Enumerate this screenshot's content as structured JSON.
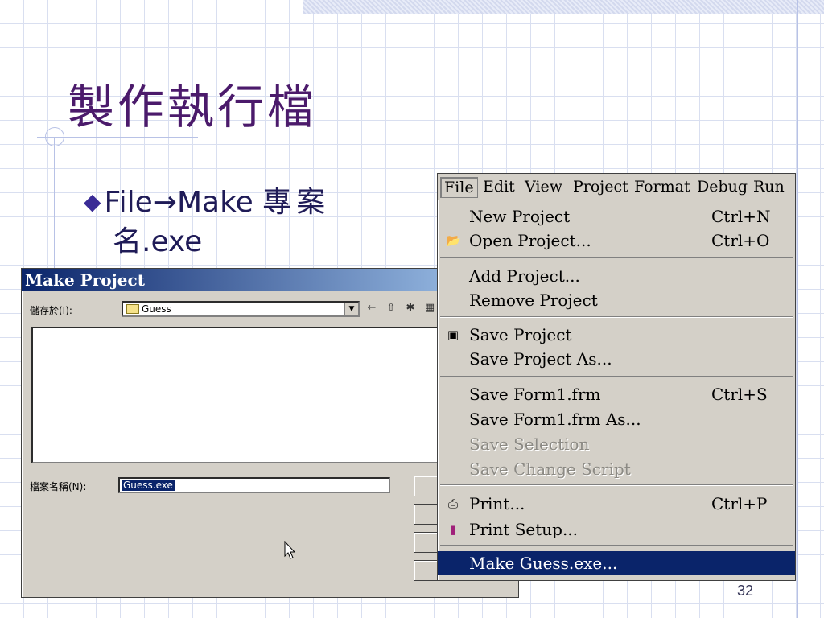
{
  "slide": {
    "title": "製作執行檔",
    "bullet_text_1": "File",
    "bullet_arrow": "→",
    "bullet_text_2": "Make ",
    "bullet_cjk_1": "專案",
    "bullet_cjk_2": "名",
    "bullet_ext": ".exe",
    "bullet_icon": "diamond-bullet-icon",
    "page_number": "32"
  },
  "dialog": {
    "title": "Make Project",
    "save_in_label": "儲存於(I):",
    "save_in_value": "Guess",
    "file_name_label": "檔案名稱(N):",
    "file_name_value": "Guess.exe",
    "toolbar_icons": [
      "back-arrow-icon",
      "up-folder-icon",
      "new-folder-icon",
      "view-menu-icon"
    ]
  },
  "menu": {
    "menubar": [
      "File",
      "Edit",
      "View",
      "Project",
      "Format",
      "Debug",
      "Run"
    ],
    "items": [
      {
        "label": "New Project",
        "shortcut": "Ctrl+N",
        "icon": "",
        "disabled": false
      },
      {
        "label": "Open Project...",
        "shortcut": "Ctrl+O",
        "icon": "open-folder-icon",
        "disabled": false
      },
      {
        "label": "Add Project...",
        "shortcut": "",
        "icon": "",
        "disabled": false
      },
      {
        "label": "Remove Project",
        "shortcut": "",
        "icon": "",
        "disabled": false
      },
      {
        "label": "Save Project",
        "shortcut": "",
        "icon": "save-disk-icon",
        "disabled": false
      },
      {
        "label": "Save Project As...",
        "shortcut": "",
        "icon": "",
        "disabled": false
      },
      {
        "label": "Save Form1.frm",
        "shortcut": "Ctrl+S",
        "icon": "",
        "disabled": false
      },
      {
        "label": "Save Form1.frm As...",
        "shortcut": "",
        "icon": "",
        "disabled": false
      },
      {
        "label": "Save Selection",
        "shortcut": "",
        "icon": "",
        "disabled": true
      },
      {
        "label": "Save Change Script",
        "shortcut": "",
        "icon": "",
        "disabled": true
      },
      {
        "label": "Print...",
        "shortcut": "Ctrl+P",
        "icon": "printer-icon",
        "disabled": false
      },
      {
        "label": "Print Setup...",
        "shortcut": "",
        "icon": "print-setup-icon",
        "disabled": false
      },
      {
        "label": "Make Guess.exe...",
        "shortcut": "",
        "icon": "",
        "disabled": false,
        "highlighted": true
      }
    ]
  },
  "colors": {
    "title": "#4b1a6b",
    "highlight": "#0a246a",
    "dialog_title_start": "#0a246a",
    "dialog_title_end": "#a6caf0"
  }
}
